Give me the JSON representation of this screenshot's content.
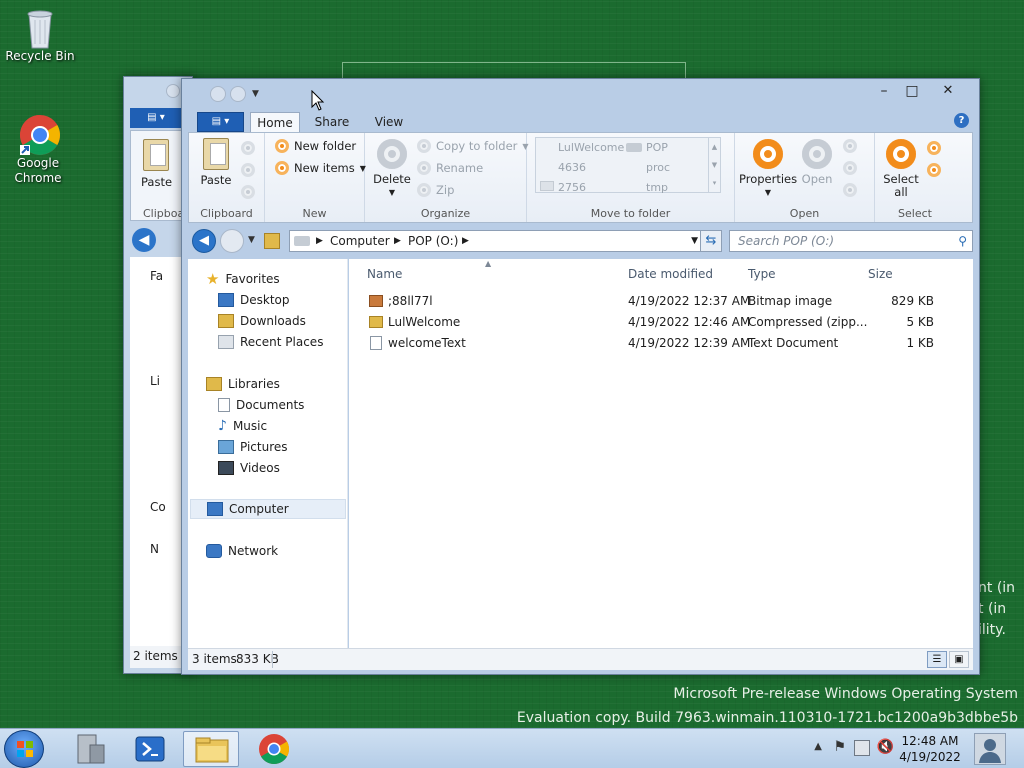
{
  "desktop": {
    "icons": [
      {
        "label": "Recycle Bin",
        "icon": "recycle-bin-icon"
      },
      {
        "label": "Google Chrome",
        "icon": "chrome-icon"
      }
    ],
    "watermark_line1": "Microsoft Pre-release Windows Operating System",
    "watermark_line2": "Evaluation copy. Build 7963.winmain.110310-1721.bc1200a9b3dbbe5b",
    "partial_text": [
      "nt (in",
      "t (in",
      "ility."
    ]
  },
  "back_window": {
    "paste_label": "Paste",
    "clipboard_label": "Clipboa",
    "status": "2 items",
    "nav_letters": [
      "Fa",
      "Li",
      "Co",
      "N"
    ]
  },
  "explorer": {
    "controls": {
      "minimize": "–",
      "maximize": "□",
      "close": "✕"
    },
    "file_tab": "▤ ▾",
    "tabs": [
      "Home",
      "Share",
      "View"
    ],
    "active_tab": "Home",
    "help": "?",
    "ribbon": {
      "clipboard": {
        "label": "Clipboard",
        "paste": "Paste"
      },
      "new": {
        "label": "New",
        "new_folder": "New folder",
        "new_items": "New items"
      },
      "organize": {
        "label": "Organize",
        "delete": "Delete",
        "copy_to": "Copy to folder",
        "rename": "Rename",
        "zip": "Zip"
      },
      "move": {
        "label": "Move to folder",
        "items": [
          "LulWelcome",
          "POP",
          "4636",
          "proc",
          "2756",
          "tmp"
        ]
      },
      "open": {
        "label": "Open",
        "properties": "Properties",
        "open": "Open"
      },
      "select": {
        "label": "Select",
        "select_all": "Select all"
      }
    },
    "address": {
      "crumbs": [
        "Computer",
        "POP (O:)"
      ]
    },
    "search_placeholder": "Search POP (O:)",
    "nav": {
      "favorites": "Favorites",
      "fav_items": [
        "Desktop",
        "Downloads",
        "Recent Places"
      ],
      "libraries": "Libraries",
      "lib_items": [
        "Documents",
        "Music",
        "Pictures",
        "Videos"
      ],
      "computer": "Computer",
      "network": "Network"
    },
    "columns": [
      "Name",
      "Date modified",
      "Type",
      "Size"
    ],
    "files": [
      {
        "name": ";88ll77l",
        "date": "4/19/2022 12:37 AM",
        "type": "Bitmap image",
        "size": "829 KB",
        "icon": "bitmap-icon"
      },
      {
        "name": "LulWelcome",
        "date": "4/19/2022 12:46 AM",
        "type": "Compressed (zipp...",
        "size": "5 KB",
        "icon": "zip-folder-icon"
      },
      {
        "name": "welcomeText",
        "date": "4/19/2022 12:39 AM",
        "type": "Text Document",
        "size": "1 KB",
        "icon": "text-file-icon"
      }
    ],
    "status": {
      "count": "3 items",
      "size": "833 KB"
    }
  },
  "taskbar": {
    "time": "12:48 AM",
    "date": "4/19/2022"
  },
  "colors": {
    "desktop": "#1b6b2f",
    "accent": "#1f5fb4",
    "orange": "#f28c1b"
  }
}
